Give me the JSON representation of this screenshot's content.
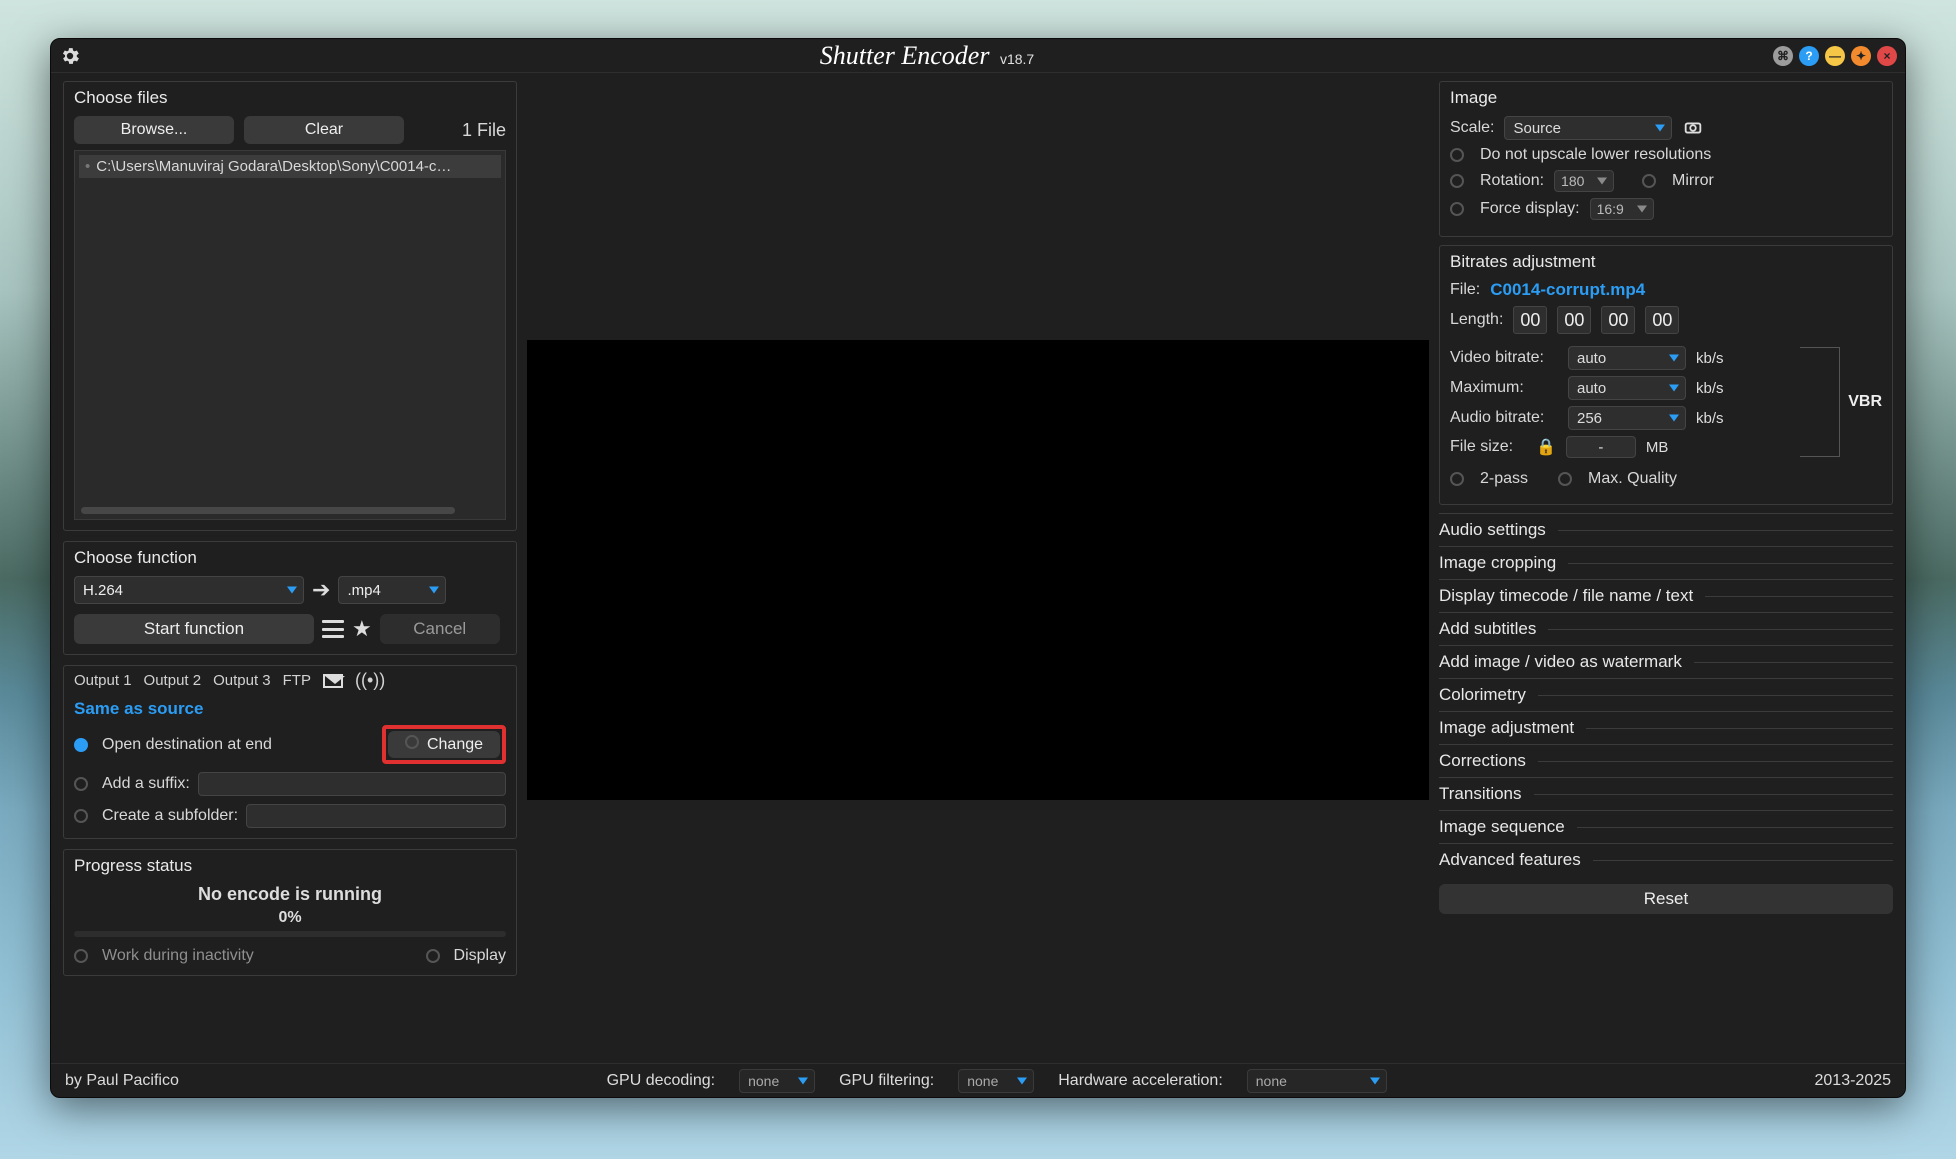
{
  "app": {
    "name": "Shutter Encoder",
    "version": "v18.7"
  },
  "choose_files": {
    "title": "Choose files",
    "browse": "Browse...",
    "clear": "Clear",
    "count": "1 File",
    "items": [
      "C:\\Users\\Manuviraj Godara\\Desktop\\Sony\\C0014-c…"
    ]
  },
  "choose_function": {
    "title": "Choose function",
    "codec": "H.264",
    "container": ".mp4",
    "start": "Start function",
    "cancel": "Cancel"
  },
  "output": {
    "tabs": [
      "Output 1",
      "Output 2",
      "Output 3",
      "FTP"
    ],
    "same_as": "Same as source",
    "open_at_end": "Open destination at end",
    "change": "Change",
    "suffix": "Add a suffix:",
    "subfolder": "Create a subfolder:"
  },
  "progress": {
    "title": "Progress status",
    "state": "No encode is running",
    "percent": "0%",
    "work_inactive": "Work during inactivity",
    "display": "Display"
  },
  "image": {
    "title": "Image",
    "scale": "Scale:",
    "scale_val": "Source",
    "no_upscale": "Do not upscale lower resolutions",
    "rotation": "Rotation:",
    "rotation_val": "180",
    "mirror": "Mirror",
    "force": "Force display:",
    "force_val": "16:9"
  },
  "bitrates": {
    "title": "Bitrates adjustment",
    "file_label": "File:",
    "file": "C0014-corrupt.mp4",
    "length": "Length:",
    "len": [
      "00",
      "00",
      "00",
      "00"
    ],
    "video": "Video bitrate:",
    "video_val": "auto",
    "max": "Maximum:",
    "max_val": "auto",
    "audio": "Audio bitrate:",
    "audio_val": "256",
    "unit": "kb/s",
    "size": "File size:",
    "size_val": "-",
    "size_unit": "MB",
    "vbr": "VBR",
    "two_pass": "2-pass",
    "max_q": "Max. Quality"
  },
  "sections": [
    "Audio settings",
    "Image cropping",
    "Display timecode / file name / text",
    "Add subtitles",
    "Add image / video as watermark",
    "Colorimetry",
    "Image adjustment",
    "Corrections",
    "Transitions",
    "Image sequence",
    "Advanced features"
  ],
  "reset": "Reset",
  "statusbar": {
    "author": "by Paul Pacifico",
    "gpu_dec": "GPU decoding:",
    "gpu_filt": "GPU filtering:",
    "hw_accel": "Hardware acceleration:",
    "none": "none",
    "years": "2013-2025"
  }
}
